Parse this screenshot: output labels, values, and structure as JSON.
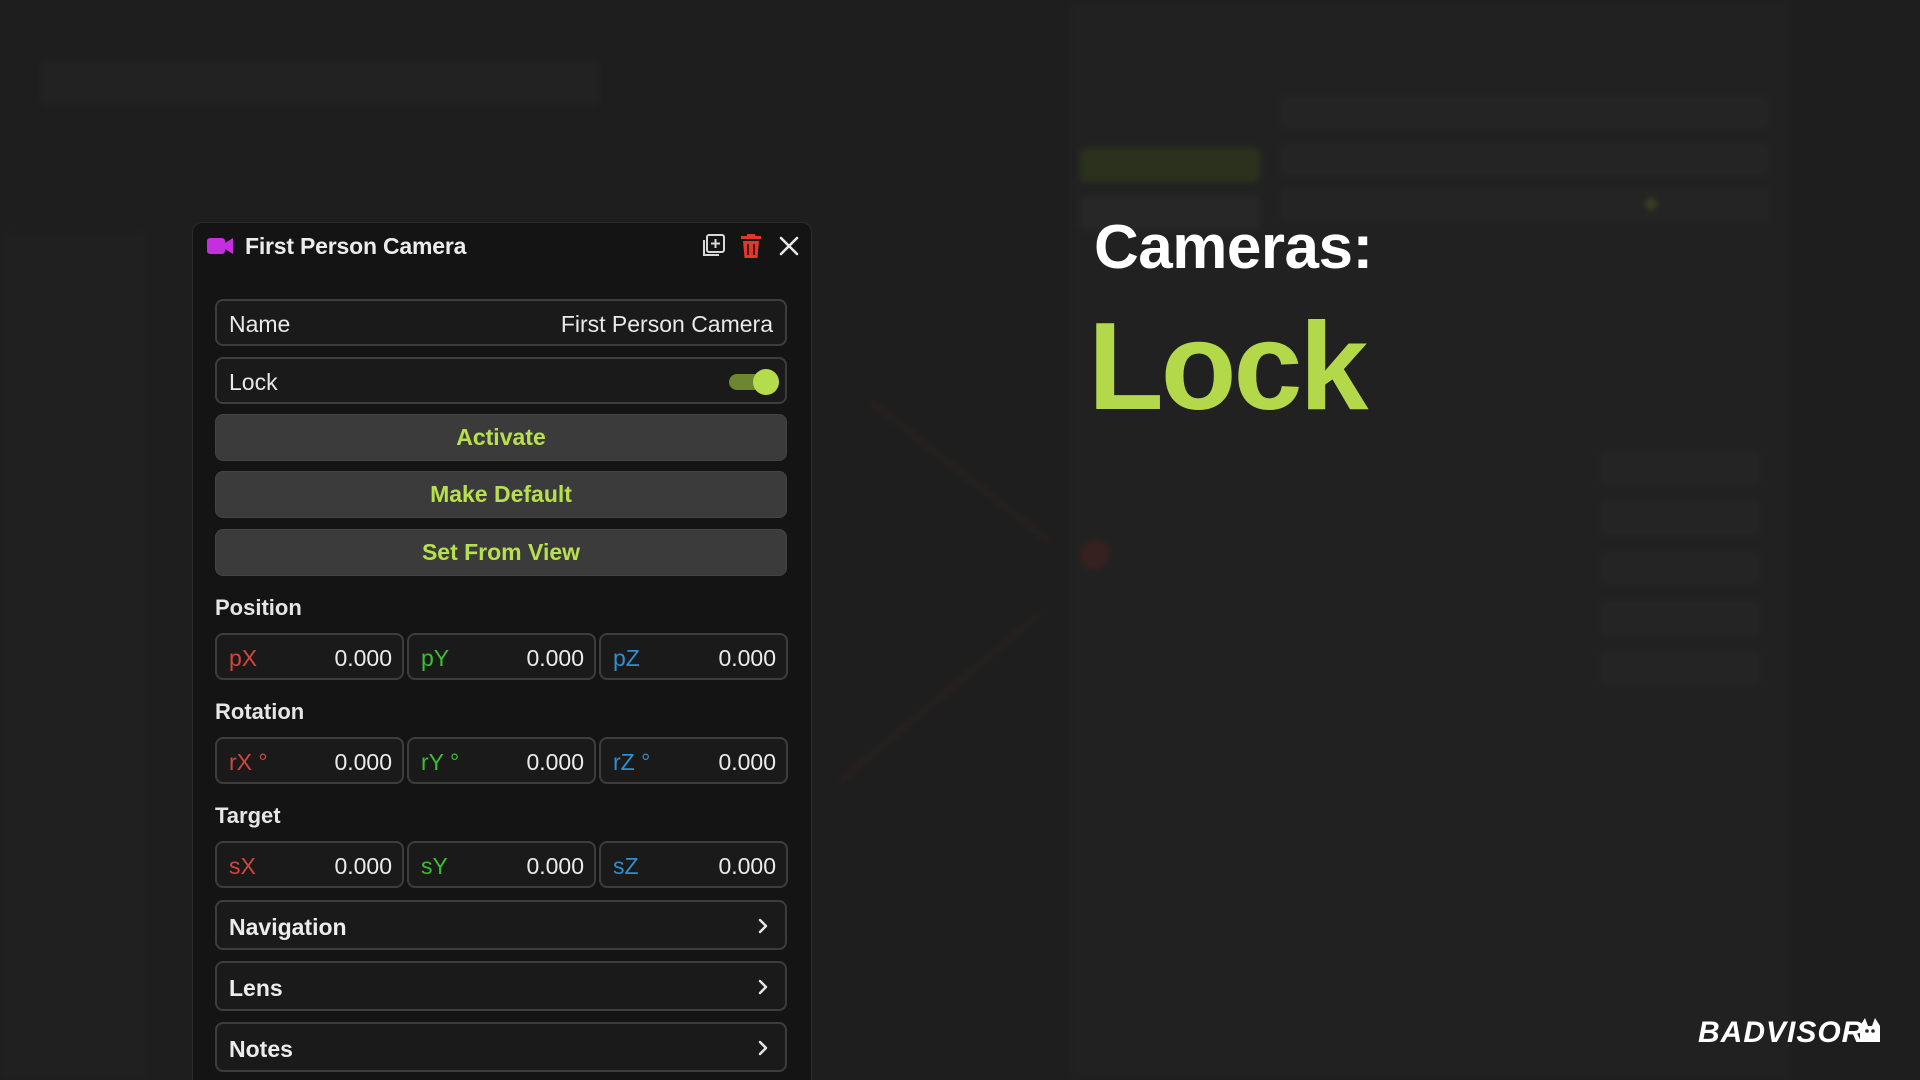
{
  "panel": {
    "title": "First Person Camera",
    "name_field": {
      "label": "Name",
      "value": "First Person Camera"
    },
    "lock_field": {
      "label": "Lock",
      "enabled": true
    },
    "buttons": {
      "activate": "Activate",
      "make_default": "Make Default",
      "set_from_view": "Set From View"
    },
    "position": {
      "label": "Position",
      "x": {
        "axis": "pX",
        "value": "0.000"
      },
      "y": {
        "axis": "pY",
        "value": "0.000"
      },
      "z": {
        "axis": "pZ",
        "value": "0.000"
      }
    },
    "rotation": {
      "label": "Rotation",
      "x": {
        "axis": "rX °",
        "value": "0.000"
      },
      "y": {
        "axis": "rY °",
        "value": "0.000"
      },
      "z": {
        "axis": "rZ °",
        "value": "0.000"
      }
    },
    "target": {
      "label": "Target",
      "x": {
        "axis": "sX",
        "value": "0.000"
      },
      "y": {
        "axis": "sY",
        "value": "0.000"
      },
      "z": {
        "axis": "sZ",
        "value": "0.000"
      }
    },
    "sections": {
      "navigation": "Navigation",
      "lens": "Lens",
      "notes": "Notes"
    },
    "icons": {
      "camera": "camera-icon",
      "duplicate": "duplicate-icon",
      "delete": "trash-icon",
      "close": "close-icon",
      "chevron": "chevron-right-icon"
    }
  },
  "headline": {
    "category": "Cameras:",
    "feature": "Lock"
  },
  "brand": {
    "name": "BADVISOR"
  },
  "colors": {
    "accent_green": "#b3d84a",
    "camera_magenta": "#c62fe0",
    "delete_red": "#e8342c",
    "axis_x": "#d2453f",
    "axis_y": "#3bbf2e",
    "axis_z": "#2e8ed2"
  }
}
